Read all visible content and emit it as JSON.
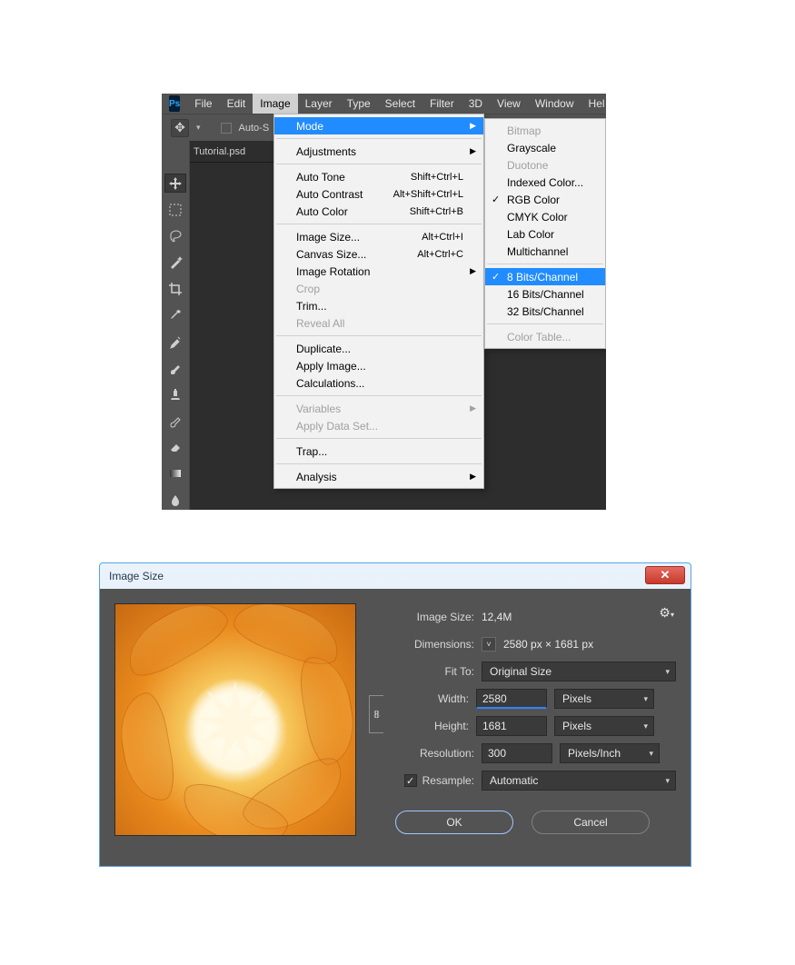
{
  "ps": {
    "app": "Ps",
    "menubar": [
      "File",
      "Edit",
      "Image",
      "Layer",
      "Type",
      "Select",
      "Filter",
      "3D",
      "View",
      "Window",
      "Hel"
    ],
    "active_menu_index": 2,
    "option_checkbox_label": "Auto-S",
    "tab_label": "Tutorial.psd",
    "image_menu": {
      "mode": {
        "label": "Mode",
        "submenu": true,
        "highlight": true
      },
      "adjustments": {
        "label": "Adjustments",
        "submenu": true
      },
      "auto_tone": {
        "label": "Auto Tone",
        "shortcut": "Shift+Ctrl+L"
      },
      "auto_contrast": {
        "label": "Auto Contrast",
        "shortcut": "Alt+Shift+Ctrl+L"
      },
      "auto_color": {
        "label": "Auto Color",
        "shortcut": "Shift+Ctrl+B"
      },
      "image_size": {
        "label": "Image Size...",
        "shortcut": "Alt+Ctrl+I"
      },
      "canvas_size": {
        "label": "Canvas Size...",
        "shortcut": "Alt+Ctrl+C"
      },
      "image_rotation": {
        "label": "Image Rotation",
        "submenu": true
      },
      "crop": {
        "label": "Crop",
        "disabled": true
      },
      "trim": {
        "label": "Trim..."
      },
      "reveal_all": {
        "label": "Reveal All",
        "disabled": true
      },
      "duplicate": {
        "label": "Duplicate..."
      },
      "apply_image": {
        "label": "Apply Image..."
      },
      "calculations": {
        "label": "Calculations..."
      },
      "variables": {
        "label": "Variables",
        "submenu": true,
        "disabled": true
      },
      "apply_data_set": {
        "label": "Apply Data Set...",
        "disabled": true
      },
      "trap": {
        "label": "Trap..."
      },
      "analysis": {
        "label": "Analysis",
        "submenu": true
      }
    },
    "mode_menu": {
      "bitmap": {
        "label": "Bitmap",
        "disabled": true
      },
      "grayscale": {
        "label": "Grayscale"
      },
      "duotone": {
        "label": "Duotone",
        "disabled": true
      },
      "indexed": {
        "label": "Indexed Color..."
      },
      "rgb": {
        "label": "RGB Color",
        "checked": true
      },
      "cmyk": {
        "label": "CMYK Color"
      },
      "lab": {
        "label": "Lab Color"
      },
      "multichannel": {
        "label": "Multichannel"
      },
      "bits8": {
        "label": "8 Bits/Channel",
        "checked": true,
        "highlight": true
      },
      "bits16": {
        "label": "16 Bits/Channel"
      },
      "bits32": {
        "label": "32 Bits/Channel"
      },
      "color_table": {
        "label": "Color Table...",
        "disabled": true
      }
    }
  },
  "dlg": {
    "title": "Image Size",
    "image_size_label": "Image Size:",
    "image_size_value": "12,4M",
    "dimensions_label": "Dimensions:",
    "dimensions_value": "2580 px  ×  1681 px",
    "fit_to_label": "Fit To:",
    "fit_to_value": "Original Size",
    "width_label": "Width:",
    "width_value": "2580",
    "width_unit": "Pixels",
    "height_label": "Height:",
    "height_value": "1681",
    "height_unit": "Pixels",
    "resolution_label": "Resolution:",
    "resolution_value": "300",
    "resolution_unit": "Pixels/Inch",
    "resample_label": "Resample:",
    "resample_value": "Automatic",
    "resample_checked": true,
    "ok": "OK",
    "cancel": "Cancel"
  }
}
